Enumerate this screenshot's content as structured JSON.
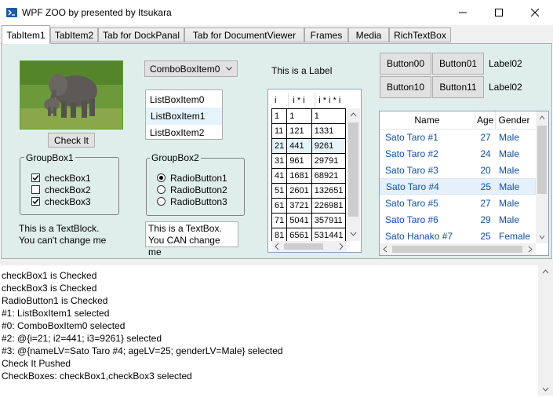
{
  "window": {
    "title": "WPF ZOO by presented by Itsukara",
    "controls": {
      "minimize": "–",
      "maximize": "☐",
      "close": "✕"
    }
  },
  "tabs": [
    "TabItem1",
    "TabItem2",
    "Tab for DockPanal",
    "Tab for DocumentViewer",
    "Frames",
    "Media",
    "RichTextBox"
  ],
  "check_button": "Check It",
  "groupbox1": {
    "label": "GroupBox1",
    "items": [
      {
        "label": "checkBox1",
        "checked": true
      },
      {
        "label": "checkBox2",
        "checked": false
      },
      {
        "label": "checkBox3",
        "checked": true
      }
    ]
  },
  "textblock": {
    "line1": "This is a TextBlock.",
    "line2": "You can't change me"
  },
  "combobox": {
    "selected": "ComboBoxItem0"
  },
  "listbox": {
    "items": [
      "ListBoxItem0",
      "ListBoxItem1",
      "ListBoxItem2"
    ],
    "selected_index": 1
  },
  "groupbox2": {
    "label": "GroupBox2",
    "items": [
      {
        "label": "RadioButton1",
        "checked": true
      },
      {
        "label": "RadioButton2",
        "checked": false
      },
      {
        "label": "RadioButton3",
        "checked": false
      }
    ]
  },
  "textbox": {
    "line1": "This is a TextBox.",
    "line2": "You CAN change me"
  },
  "label_main": "This is a Label",
  "datagrid": {
    "headers": [
      "i",
      "i * i",
      "i * i * i"
    ],
    "rows": [
      [
        "1",
        "1",
        "1"
      ],
      [
        "11",
        "121",
        "1331"
      ],
      [
        "21",
        "441",
        "9261"
      ],
      [
        "31",
        "961",
        "29791"
      ],
      [
        "41",
        "1681",
        "68921"
      ],
      [
        "51",
        "2601",
        "132651"
      ],
      [
        "61",
        "3721",
        "226981"
      ],
      [
        "71",
        "5041",
        "357911"
      ],
      [
        "81",
        "6561",
        "531441"
      ]
    ],
    "selected_index": 2
  },
  "buttons": [
    "Button00",
    "Button01",
    "Button10",
    "Button11"
  ],
  "labels_right": [
    "Label02",
    "Label02"
  ],
  "listview": {
    "headers": [
      "Name",
      "Age",
      "Gender"
    ],
    "rows": [
      {
        "name": "Sato Taro #1",
        "age": "27",
        "gender": "Male"
      },
      {
        "name": "Sato Taro #2",
        "age": "24",
        "gender": "Male"
      },
      {
        "name": "Sato Taro #3",
        "age": "20",
        "gender": "Male"
      },
      {
        "name": "Sato Taro #4",
        "age": "25",
        "gender": "Male"
      },
      {
        "name": "Sato Taro #5",
        "age": "27",
        "gender": "Male"
      },
      {
        "name": "Sato Taro #6",
        "age": "29",
        "gender": "Male"
      },
      {
        "name": "Sato Hanako #7",
        "age": "25",
        "gender": "Female"
      }
    ],
    "selected_index": 3
  },
  "log": [
    "checkBox1 is Checked",
    "checkBox3 is Checked",
    "RadioButton1 is Checked",
    "#1: ListBoxItem1 selected",
    "#0: ComboBoxItem0 selected",
    "#2: @{i=21; i2=441; i3=9261} selected",
    "#3: @{nameLV=Sato Taro #4; ageLV=25; genderLV=Male} selected",
    "Check It Pushed",
    "CheckBoxes: checkBox1,checkBox3 selected"
  ]
}
